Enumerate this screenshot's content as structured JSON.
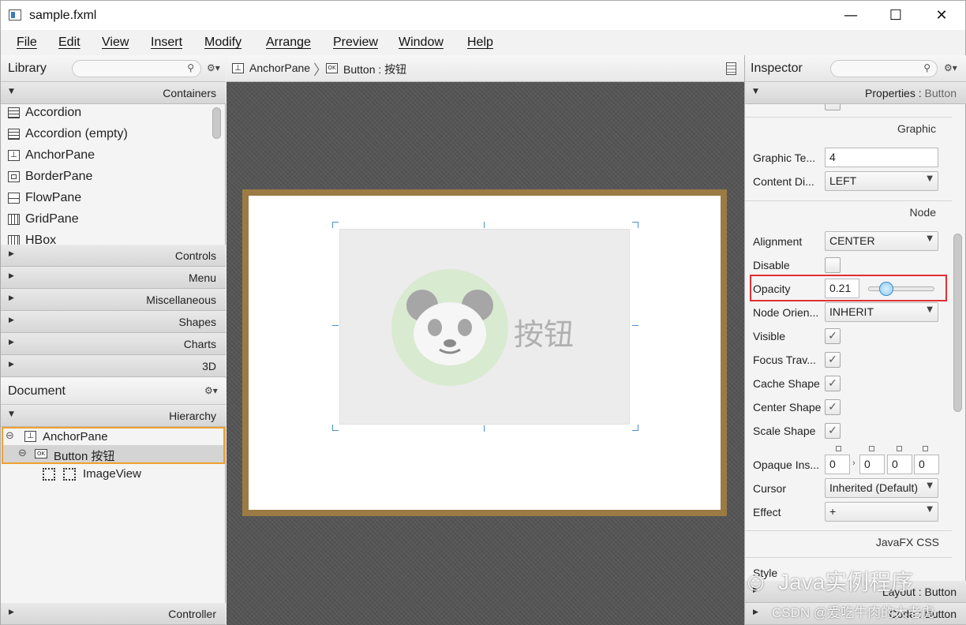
{
  "window": {
    "title": "sample.fxml",
    "minimize": "—",
    "maximize": "☐",
    "close": "✕"
  },
  "menu": [
    "File",
    "Edit",
    "View",
    "Insert",
    "Modify",
    "Arrange",
    "Preview",
    "Window",
    "Help"
  ],
  "library": {
    "title": "Library",
    "section_containers": "Containers",
    "items": [
      "Accordion",
      "Accordion  (empty)",
      "AnchorPane",
      "BorderPane",
      "FlowPane",
      "GridPane",
      "HBox"
    ],
    "sections": [
      "Controls",
      "Menu",
      "Miscellaneous",
      "Shapes",
      "Charts",
      "3D"
    ]
  },
  "document": {
    "title": "Document",
    "hierarchy_label": "Hierarchy",
    "tree": [
      {
        "label": "AnchorPane",
        "toggle": "⊖",
        "icon": "anchorpane-icon"
      },
      {
        "label": "Button  按钮",
        "toggle": "⊖",
        "icon": "button-icon"
      },
      {
        "label": "ImageView",
        "icon": "imageview-icon"
      }
    ],
    "controller_label": "Controller"
  },
  "breadcrumb": {
    "items": [
      {
        "label": "AnchorPane",
        "icon": "anchorpane-icon",
        "icon_text": "⊥"
      },
      {
        "label": "Button : 按钮",
        "icon": "button-icon",
        "icon_text": "OK"
      }
    ]
  },
  "canvas": {
    "button_text": "按钮"
  },
  "inspector": {
    "title": "Inspector",
    "properties_label": "Properties",
    "properties_target": "Button",
    "groups": {
      "graphic": "Graphic",
      "node": "Node",
      "css": "JavaFX CSS"
    },
    "graphic_text_gap_label": "Graphic Te...",
    "graphic_text_gap_value": "4",
    "content_display_label": "Content Di...",
    "content_display_value": "LEFT",
    "alignment_label": "Alignment",
    "alignment_value": "CENTER",
    "disable_label": "Disable",
    "opacity_label": "Opacity",
    "opacity_value": "0.21",
    "opacity_slider_fraction": 0.21,
    "node_orientation_label": "Node Orien...",
    "node_orientation_value": "INHERIT",
    "visible_label": "Visible",
    "focus_traversable_label": "Focus Trav...",
    "cache_shape_label": "Cache Shape",
    "center_shape_label": "Center Shape",
    "scale_shape_label": "Scale Shape",
    "opaque_insets_label": "Opaque Ins...",
    "opaque_insets_values": [
      "0",
      "0",
      "0",
      "0"
    ],
    "cursor_label": "Cursor",
    "cursor_value": "Inherited (Default)",
    "effect_label": "Effect",
    "effect_value": "+",
    "layout_label": "Layout : Button",
    "code_label": "Code : Button",
    "partial_style_label": "Style",
    "highlight_color": "#e03030"
  },
  "watermark": {
    "line1": "Java实例程序",
    "line2": "CSDN @爱吃牛肉的大老虎"
  },
  "colors": {
    "anchor_border": "#9b7b43",
    "selection": "#4a8fd0",
    "tree_select_border": "#f0a030"
  }
}
